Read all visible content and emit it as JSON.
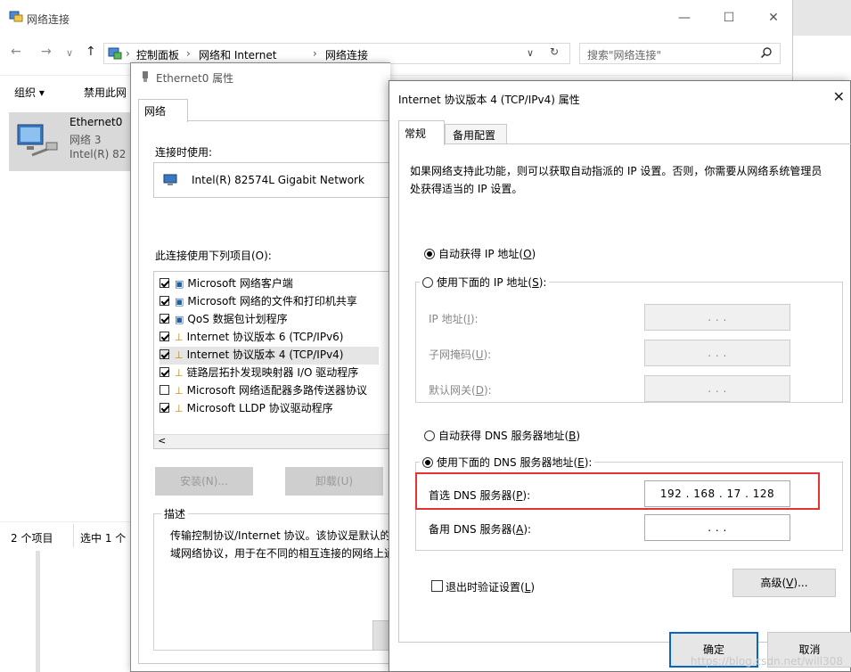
{
  "explorer": {
    "title": "网络连接",
    "nav_back": "←",
    "nav_forward": "→",
    "nav_recent": "∨",
    "nav_up": "↑",
    "breadcrumb": [
      "控制面板",
      "网络和 Internet",
      "网络连接"
    ],
    "breadcrumb_sep": "›",
    "addr_dropdown": "∨",
    "refresh": "↻",
    "search_placeholder": "搜索\"网络连接\"",
    "toolbar": {
      "organize": "组织 ▾",
      "disable": "禁用此网"
    },
    "item": {
      "name": "Ethernet0",
      "network": "网络 3",
      "device": "Intel(R) 82"
    },
    "status": {
      "count": "2 个项目",
      "selected": "选中 1 个"
    },
    "caption": {
      "min": "—",
      "max": "☐",
      "close": "✕"
    }
  },
  "eth_dialog": {
    "title": "Ethernet0 属性",
    "tab": "网络",
    "connect_using": "连接时使用:",
    "adapter": "Intel(R) 82574L Gigabit Network",
    "items_label": "此连接使用下列项目(O):",
    "items": [
      {
        "label": "Microsoft 网络客户端",
        "checked": true
      },
      {
        "label": "Microsoft 网络的文件和打印机共享",
        "checked": true
      },
      {
        "label": "QoS 数据包计划程序",
        "checked": true
      },
      {
        "label": "Internet 协议版本 6 (TCP/IPv6)",
        "checked": true
      },
      {
        "label": "Internet 协议版本 4 (TCP/IPv4)",
        "checked": true
      },
      {
        "label": "链路层拓扑发现映射器 I/O 驱动程序",
        "checked": true
      },
      {
        "label": "Microsoft 网络适配器多路传送器协议",
        "checked": false
      },
      {
        "label": "Microsoft LLDP 协议驱动程序",
        "checked": true
      }
    ],
    "scroll_left": "<",
    "install": "安装(N)...",
    "uninstall": "卸载(U)",
    "desc_group": "描述",
    "desc_text": "传输控制协议/Internet 协议。该协议是默认的广域网络协议，用于在不同的相互连接的网络上通信。"
  },
  "ipv4_dialog": {
    "title": "Internet 协议版本 4 (TCP/IPv4) 属性",
    "close": "✕",
    "tabs": [
      "常规",
      "备用配置"
    ],
    "intro": "如果网络支持此功能，则可以获取自动指派的 IP 设置。否则，你需要从网络系统管理员处获得适当的 IP 设置。",
    "auto_ip": {
      "pre": "自动获得 IP 地址(",
      "key": "O",
      "post": ")"
    },
    "manual_ip": {
      "pre": "使用下面的 IP 地址(",
      "key": "S",
      "post": "):"
    },
    "ip_addr": {
      "pre": "IP 地址(",
      "key": "I",
      "post": "):"
    },
    "subnet": {
      "pre": "子网掩码(",
      "key": "U",
      "post": "):"
    },
    "gateway": {
      "pre": "默认网关(",
      "key": "D",
      "post": "):"
    },
    "empty_ip": ".       .       .",
    "auto_dns": {
      "pre": "自动获得 DNS 服务器地址(",
      "key": "B",
      "post": ")"
    },
    "manual_dns": {
      "pre": "使用下面的 DNS 服务器地址(",
      "key": "E",
      "post": "):"
    },
    "pref_dns": {
      "pre": "首选 DNS 服务器(",
      "key": "P",
      "post": "):"
    },
    "pref_dns_value": "192 . 168 . 17 . 128",
    "alt_dns": {
      "pre": "备用 DNS 服务器(",
      "key": "A",
      "post": "):"
    },
    "validate": {
      "pre": "退出时验证设置(",
      "key": "L",
      "post": ")"
    },
    "advanced": {
      "pre": "高级(",
      "key": "V",
      "post": ")..."
    },
    "ok": "确定",
    "cancel": "取消",
    "watermark": "https://blog.csdn.net/will308"
  }
}
